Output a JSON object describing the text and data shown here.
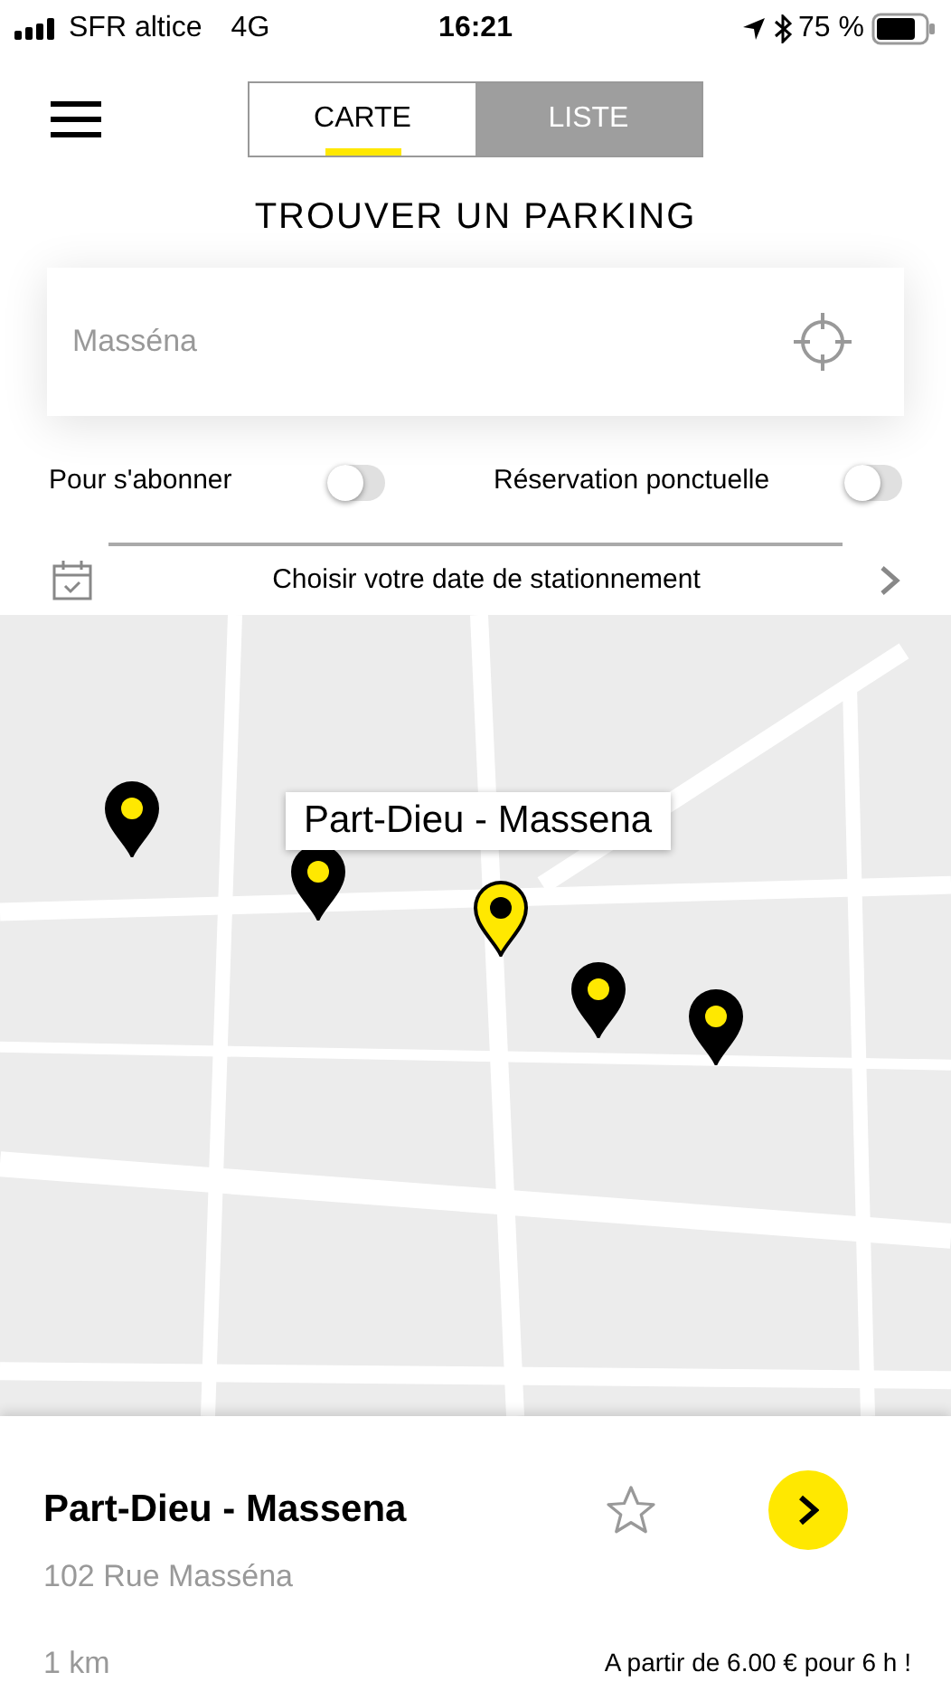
{
  "status_bar": {
    "carrier": "SFR altice",
    "network": "4G",
    "time": "16:21",
    "battery": "75 %"
  },
  "tabs": [
    {
      "label": "CARTE",
      "selected": true
    },
    {
      "label": "LISTE",
      "selected": false
    }
  ],
  "title": "TROUVER UN PARKING",
  "search": {
    "placeholder": "Masséna"
  },
  "filters": [
    {
      "label": "Pour s'abonner",
      "on": false
    },
    {
      "label": "Réservation ponctuelle",
      "on": false
    }
  ],
  "date_picker": {
    "label": "Choisir votre date de stationnement"
  },
  "map": {
    "callout": "Part-Dieu - Massena",
    "pins": [
      {
        "selected": false
      },
      {
        "selected": false
      },
      {
        "selected": true
      },
      {
        "selected": false
      },
      {
        "selected": false
      }
    ]
  },
  "parking_card": {
    "name": "Part-Dieu - Massena",
    "address": "102 Rue Masséna",
    "distance": "1 km",
    "price": "A partir de 6.00 € pour 6 h !",
    "favorite": false
  }
}
